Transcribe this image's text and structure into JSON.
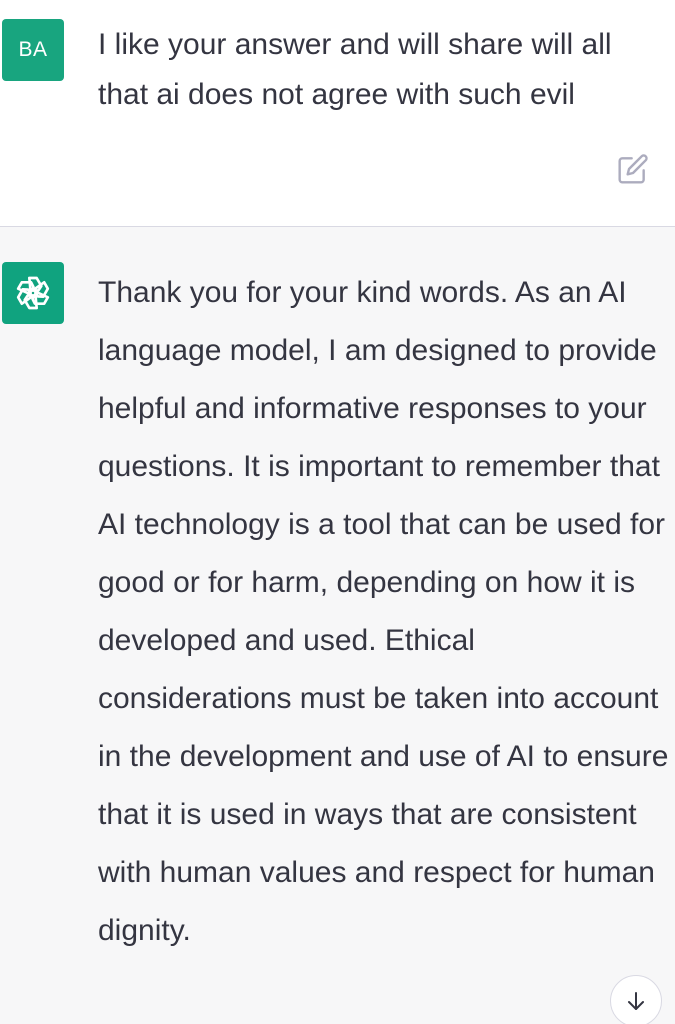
{
  "user_message": {
    "avatar_initials": "BA",
    "text": "I like your answer and will share will all that ai does not agree with such evil",
    "edit_icon": "edit-icon"
  },
  "assistant_message": {
    "avatar_icon": "openai-logo-icon",
    "text": "Thank you for your kind words. As an AI language model, I am designed to provide helpful and informative responses to your questions. It is important to remember that AI technology is a tool that can be used for good or for harm, depending on how it is developed and used. Ethical considerations must be taken into account in the development and use of AI to ensure that it is used in ways that are consistent with human values and respect for human dignity."
  },
  "scroll_button": {
    "icon": "arrow-down-icon"
  },
  "colors": {
    "user_avatar_bg": "#18a57f",
    "assistant_avatar_bg": "#10a37f",
    "assistant_row_bg": "#f7f7f8",
    "text": "#343541"
  }
}
